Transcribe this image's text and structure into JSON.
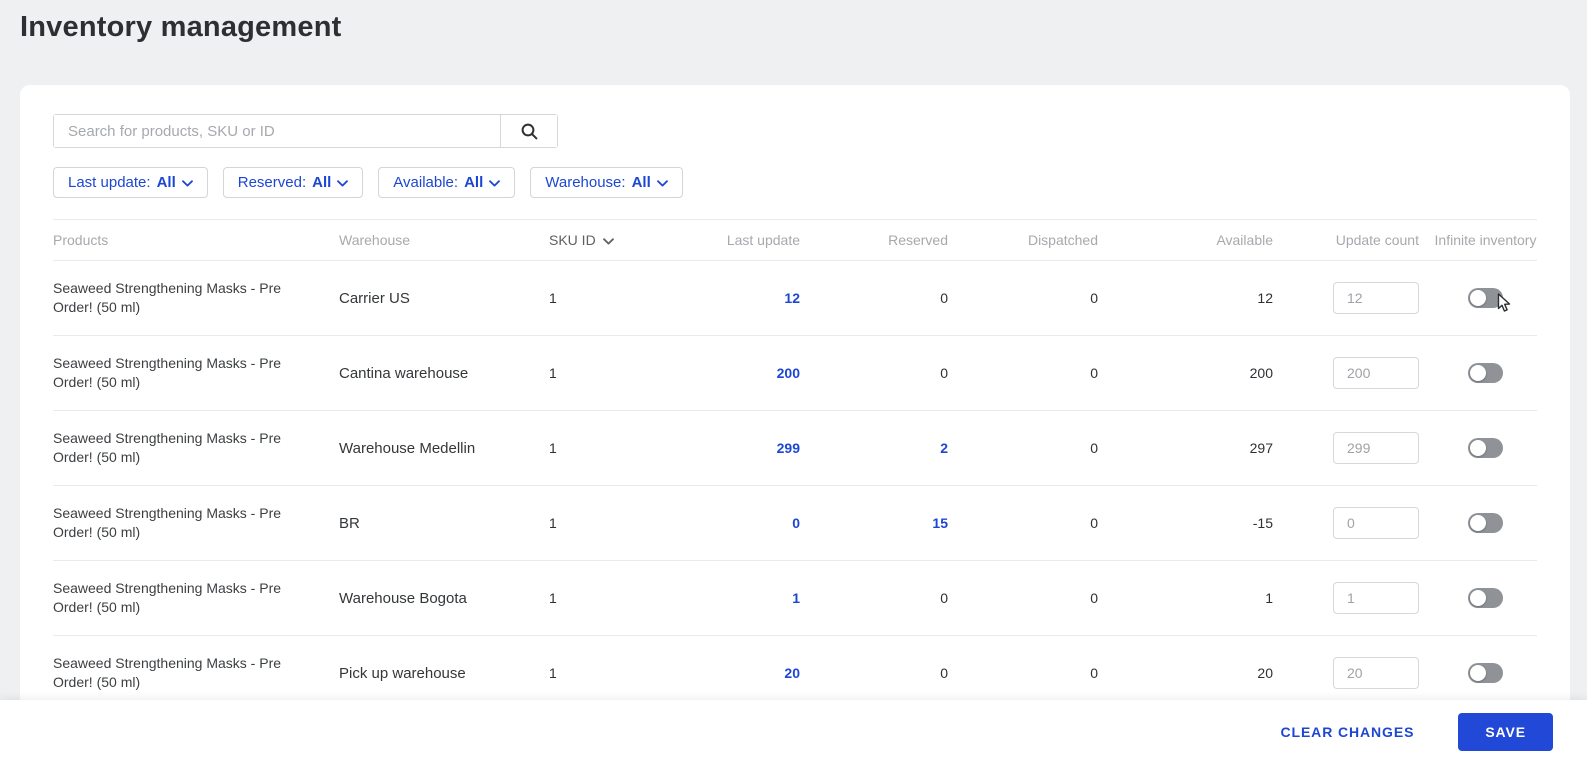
{
  "page": {
    "title": "Inventory management"
  },
  "search": {
    "placeholder": "Search for products, SKU or ID"
  },
  "filters": [
    {
      "label": "Last update:",
      "value": "All"
    },
    {
      "label": "Reserved:",
      "value": "All"
    },
    {
      "label": "Available:",
      "value": "All"
    },
    {
      "label": "Warehouse:",
      "value": "All"
    }
  ],
  "table": {
    "columns": {
      "products": "Products",
      "warehouse": "Warehouse",
      "sku_id": "SKU ID",
      "last_update": "Last update",
      "reserved": "Reserved",
      "dispatched": "Dispatched",
      "available": "Available",
      "update_count": "Update count",
      "infinite_inventory": "Infinite inventory"
    },
    "rows": [
      {
        "product": "Seaweed Strengthening Masks - Pre Order! (50 ml)",
        "warehouse": "Carrier US",
        "sku_id": "1",
        "last_update": "12",
        "reserved": "0",
        "dispatched": "0",
        "available": "12",
        "update_count": "12",
        "infinite_inventory": false
      },
      {
        "product": "Seaweed Strengthening Masks - Pre Order! (50 ml)",
        "warehouse": "Cantina warehouse",
        "sku_id": "1",
        "last_update": "200",
        "reserved": "0",
        "dispatched": "0",
        "available": "200",
        "update_count": "200",
        "infinite_inventory": false
      },
      {
        "product": "Seaweed Strengthening Masks - Pre Order! (50 ml)",
        "warehouse": "Warehouse Medellin",
        "sku_id": "1",
        "last_update": "299",
        "reserved": "2",
        "dispatched": "0",
        "available": "297",
        "update_count": "299",
        "infinite_inventory": false
      },
      {
        "product": "Seaweed Strengthening Masks - Pre Order! (50 ml)",
        "warehouse": "BR",
        "sku_id": "1",
        "last_update": "0",
        "reserved": "15",
        "dispatched": "0",
        "available": "-15",
        "update_count": "0",
        "infinite_inventory": false
      },
      {
        "product": "Seaweed Strengthening Masks - Pre Order! (50 ml)",
        "warehouse": "Warehouse Bogota",
        "sku_id": "1",
        "last_update": "1",
        "reserved": "0",
        "dispatched": "0",
        "available": "1",
        "update_count": "1",
        "infinite_inventory": false
      },
      {
        "product": "Seaweed Strengthening Masks - Pre Order! (50 ml)",
        "warehouse": "Pick up warehouse",
        "sku_id": "1",
        "last_update": "20",
        "reserved": "0",
        "dispatched": "0",
        "available": "20",
        "update_count": "20",
        "infinite_inventory": false
      }
    ]
  },
  "footer": {
    "clear_label": "CLEAR CHANGES",
    "save_label": "SAVE"
  },
  "colors": {
    "accent_blue": "#2148d6",
    "page_background": "#eef0f2",
    "toggle_off_track": "#8f9297"
  }
}
